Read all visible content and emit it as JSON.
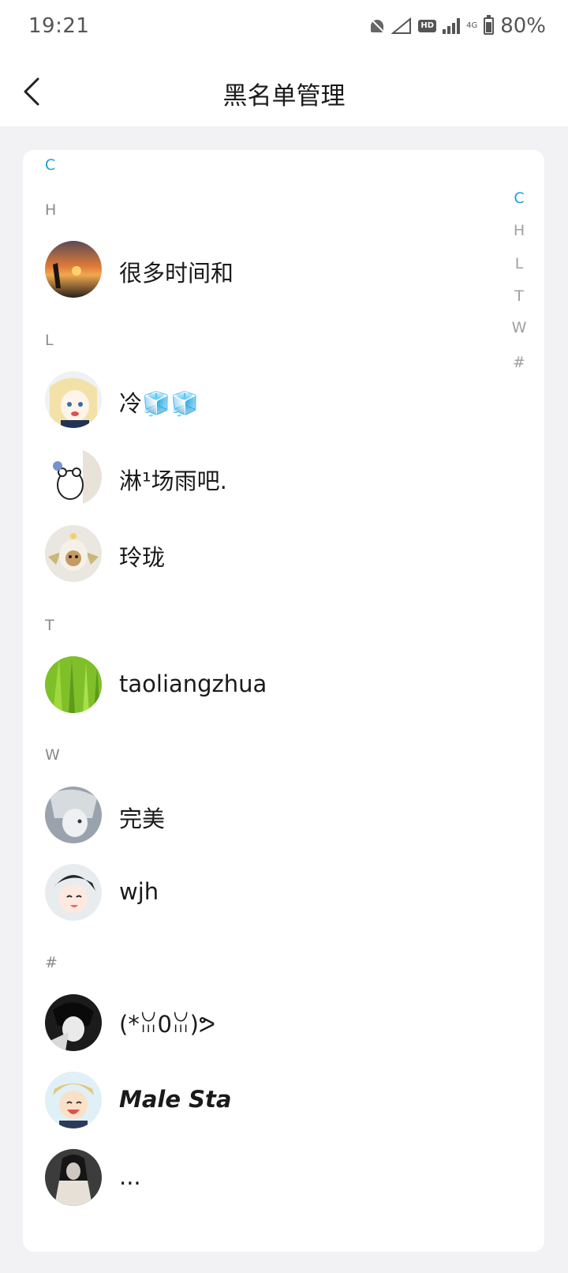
{
  "status_bar": {
    "time": "19:21",
    "battery": "80%",
    "hd_label": "HD",
    "network_label": "4G",
    "battery_level": 0.8
  },
  "header": {
    "title": "黑名单管理"
  },
  "colors": {
    "accent": "#1aa3d9",
    "background": "#f2f2f5",
    "card": "#ffffff"
  },
  "sections": [
    {
      "letter": "C"
    },
    {
      "letter": "H"
    },
    {
      "letter": "L"
    },
    {
      "letter": "T"
    },
    {
      "letter": "W"
    },
    {
      "letter": "#"
    }
  ],
  "contacts": [
    {
      "name": "很多时间和",
      "avatar": "sunset-avatar"
    },
    {
      "name": "冷🧊🧊",
      "avatar": "anime-girl-blonde-avatar"
    },
    {
      "name": "淋¹场雨吧.",
      "avatar": "cartoon-bear-avatar"
    },
    {
      "name": "玲珑",
      "avatar": "puppy-costume-avatar"
    },
    {
      "name": "taoliangzhua",
      "avatar": "green-grass-avatar"
    },
    {
      "name": "完美",
      "avatar": "anime-silver-hair-avatar"
    },
    {
      "name": "wjh",
      "avatar": "anime-dark-hair-smile-avatar"
    },
    {
      "name": "(*ꈍ0ꈍ)ᕗ",
      "avatar": "anime-dark-boy-avatar"
    },
    {
      "name": "Male Sta",
      "avatar": "anime-blonde-laugh-avatar"
    },
    {
      "name": "...",
      "avatar": "dark-photo-avatar"
    }
  ],
  "index_bar": [
    "C",
    "H",
    "L",
    "T",
    "W",
    "#"
  ]
}
